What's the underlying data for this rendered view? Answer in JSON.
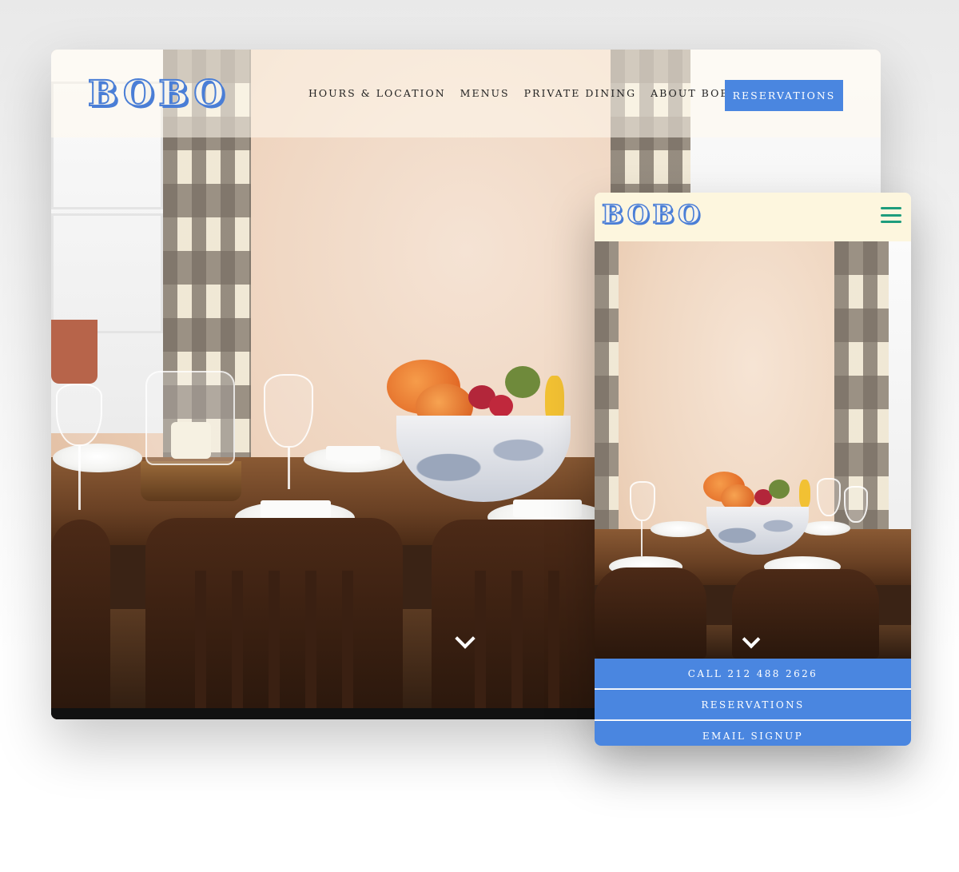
{
  "desktop": {
    "logo": "BOBO",
    "nav": [
      "HOURS & LOCATION",
      "MENUS",
      "PRIVATE DINING",
      "ABOUT BOBO"
    ],
    "reservations_label": "RESERVATIONS",
    "scroll_icon": "chevron-down-icon"
  },
  "mobile": {
    "logo": "BOBO",
    "menu_icon": "hamburger-menu-icon",
    "scroll_icon": "chevron-down-icon",
    "buttons": [
      "CALL 212 488 2626",
      "RESERVATIONS",
      "EMAIL SIGNUP"
    ]
  },
  "colors": {
    "brand_blue": "#4a86e0",
    "mobile_header": "#fdf6de",
    "hamburger": "#1e9d7d"
  }
}
